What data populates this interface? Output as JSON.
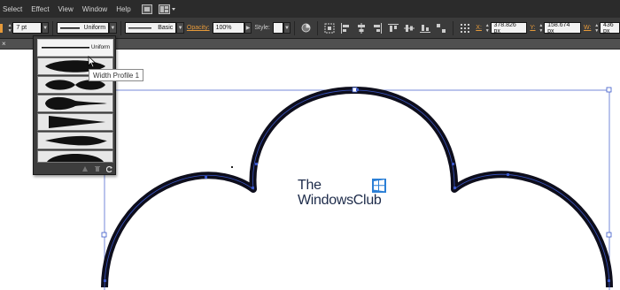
{
  "menubar": {
    "items": [
      "Select",
      "Effect",
      "View",
      "Window",
      "Help"
    ]
  },
  "controlbar": {
    "stroke_weight": "7 pt",
    "variable_width_profile": "Uniform",
    "brush_definition": "Basic",
    "opacity_label": "Opacity:",
    "opacity_value": "100%",
    "style_label": "Style:",
    "x_label": "X:",
    "x_value": "378.826 px",
    "y_label": "Y:",
    "y_value": "158.674 px",
    "w_label": "W:",
    "w_value": "436 px",
    "colors": {
      "accent_label": "#e69a3a",
      "path_selection": "#3a57c8"
    }
  },
  "tabstrip": {
    "close_glyph": "×"
  },
  "width_profile_panel": {
    "profiles": [
      {
        "label": "Uniform",
        "shape": "uniform"
      },
      {
        "label": "",
        "shape": "bulge-center"
      },
      {
        "label": "",
        "shape": "double-bulge"
      },
      {
        "label": "",
        "shape": "bulge-left"
      },
      {
        "label": "",
        "shape": "taper-right-wedge"
      },
      {
        "label": "",
        "shape": "leaf"
      },
      {
        "label": "",
        "shape": "dome"
      }
    ],
    "footer_icons": [
      "add-to-profiles-icon",
      "delete-profile-icon",
      "reset-profiles-icon"
    ]
  },
  "tooltip": {
    "text": "Width Profile 1"
  },
  "watermark": {
    "line1": "The",
    "line2": "WindowsClub"
  }
}
